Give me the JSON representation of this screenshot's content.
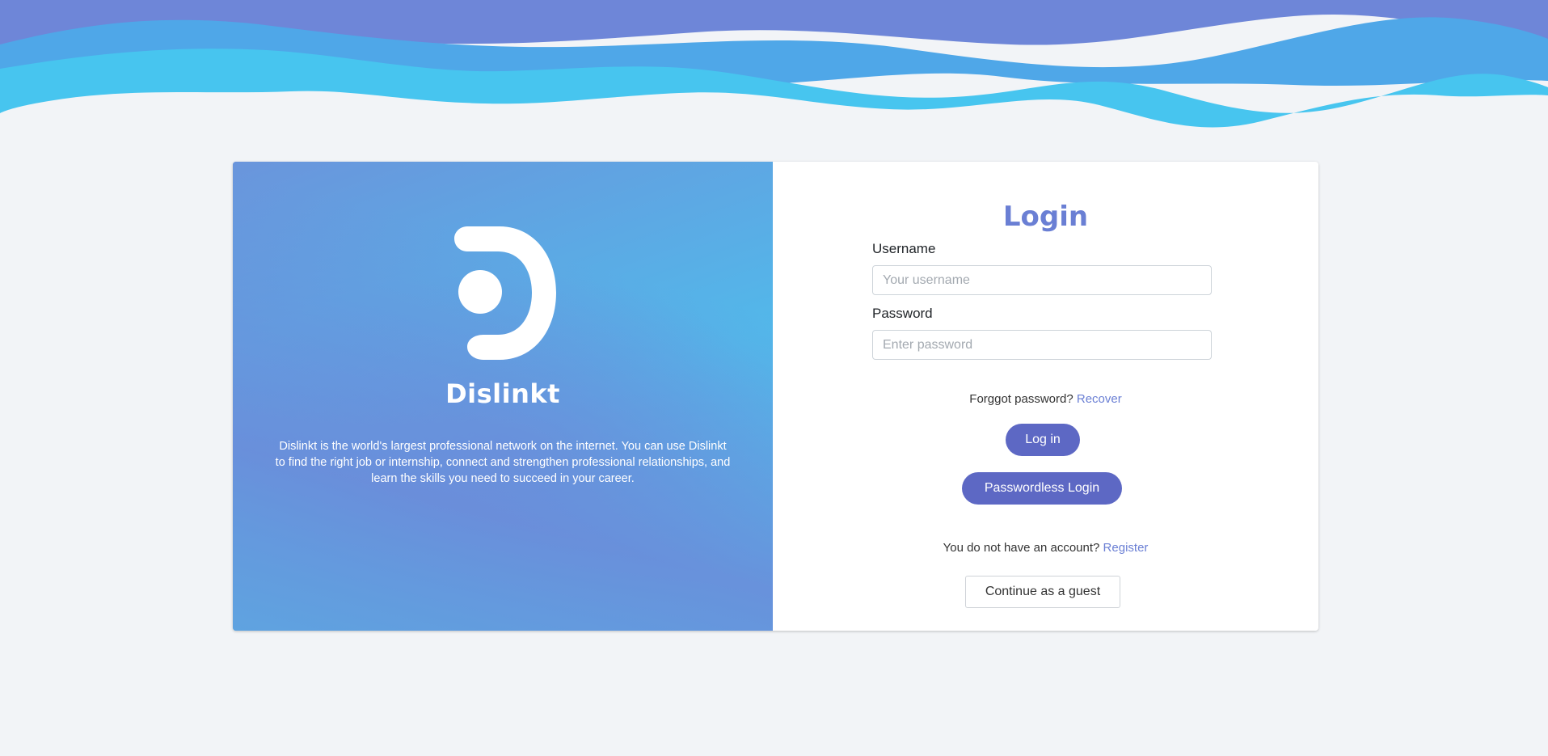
{
  "brand": {
    "name": "Dislinkt",
    "description": "Dislinkt is the world's largest professional network on the internet. You can use Dislinkt to find the right job or internship, connect and strengthen professional relationships, and learn the skills you need to succeed in your career.",
    "logo_icon": "dislinkt-logo-icon"
  },
  "login": {
    "title": "Login",
    "username_label": "Username",
    "username_placeholder": "Your username",
    "username_value": "",
    "password_label": "Password",
    "password_placeholder": "Enter password",
    "password_value": "",
    "forgot_text": "Forggot password?",
    "recover_link": "Recover",
    "login_button": "Log in",
    "passwordless_button": "Passwordless Login",
    "no_account_text": "You do not have an account?",
    "register_link": "Register",
    "guest_button": "Continue as a guest"
  },
  "colors": {
    "accent": "#5d68c4",
    "title": "#6a7fd4",
    "wave_dark": "#6e86d8",
    "wave_mid": "#4fa7e8",
    "wave_light": "#47c5ef",
    "background": "#f2f4f7"
  }
}
